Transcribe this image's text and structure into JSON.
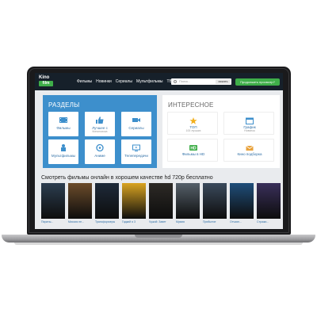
{
  "logo": {
    "line1": "Kino",
    "line2": "film"
  },
  "nav": {
    "links": [
      "Фильмы",
      "Новинки",
      "Сериалы",
      "Мультфильмы",
      "ТВ"
    ],
    "search_placeholder": "Поиск...",
    "search_button": "искать",
    "watch_button": "Продолжить просмотр?"
  },
  "sections": {
    "title": "РАЗДЕЛЫ",
    "tiles": [
      {
        "label": "Фильмы",
        "sub": "",
        "icon": "film-icon"
      },
      {
        "label": "Лучшее с",
        "sub": "Кинопоиска",
        "icon": "thumbs-up-icon"
      },
      {
        "label": "Сериалы",
        "sub": "",
        "icon": "video-camera-icon"
      },
      {
        "label": "Мультфильмы",
        "sub": "",
        "icon": "cartoon-icon"
      },
      {
        "label": "Аниме",
        "sub": "",
        "icon": "anime-icon"
      },
      {
        "label": "Телепередачи",
        "sub": "",
        "icon": "tv-icon"
      }
    ]
  },
  "interesting": {
    "title": "ИНТЕРЕСНОЕ",
    "tiles": [
      {
        "label": "ТОП",
        "sub": "100 лучших",
        "icon": "star-icon"
      },
      {
        "label": "График",
        "sub": "Новинок",
        "icon": "calendar-icon"
      },
      {
        "label": "Фильмы в HD",
        "sub": "",
        "icon": "hd-icon"
      },
      {
        "label": "Кино подборка",
        "sub": "",
        "icon": "envelope-icon"
      }
    ]
  },
  "heading": "Смотреть фильмы онлайн в хорошем качестве hd 720p бесплатно",
  "posters": [
    {
      "caption": "Пираты...",
      "color": "#2c3e50"
    },
    {
      "caption": "Миссия не...",
      "color": "#6b4b2a"
    },
    {
      "caption": "Трансформеры",
      "color": "#1e2a3a"
    },
    {
      "caption": "Гадкий я 3",
      "color": "#d9a321"
    },
    {
      "caption": "Чужой: Завет",
      "color": "#2d2a26"
    },
    {
      "caption": "Мумия",
      "color": "#55606a"
    },
    {
      "caption": "Прибытие",
      "color": "#3b4a5c"
    },
    {
      "caption": "Отчаян...",
      "color": "#1f4e7a"
    },
    {
      "caption": "Стражи...",
      "color": "#3a2f5a"
    }
  ]
}
